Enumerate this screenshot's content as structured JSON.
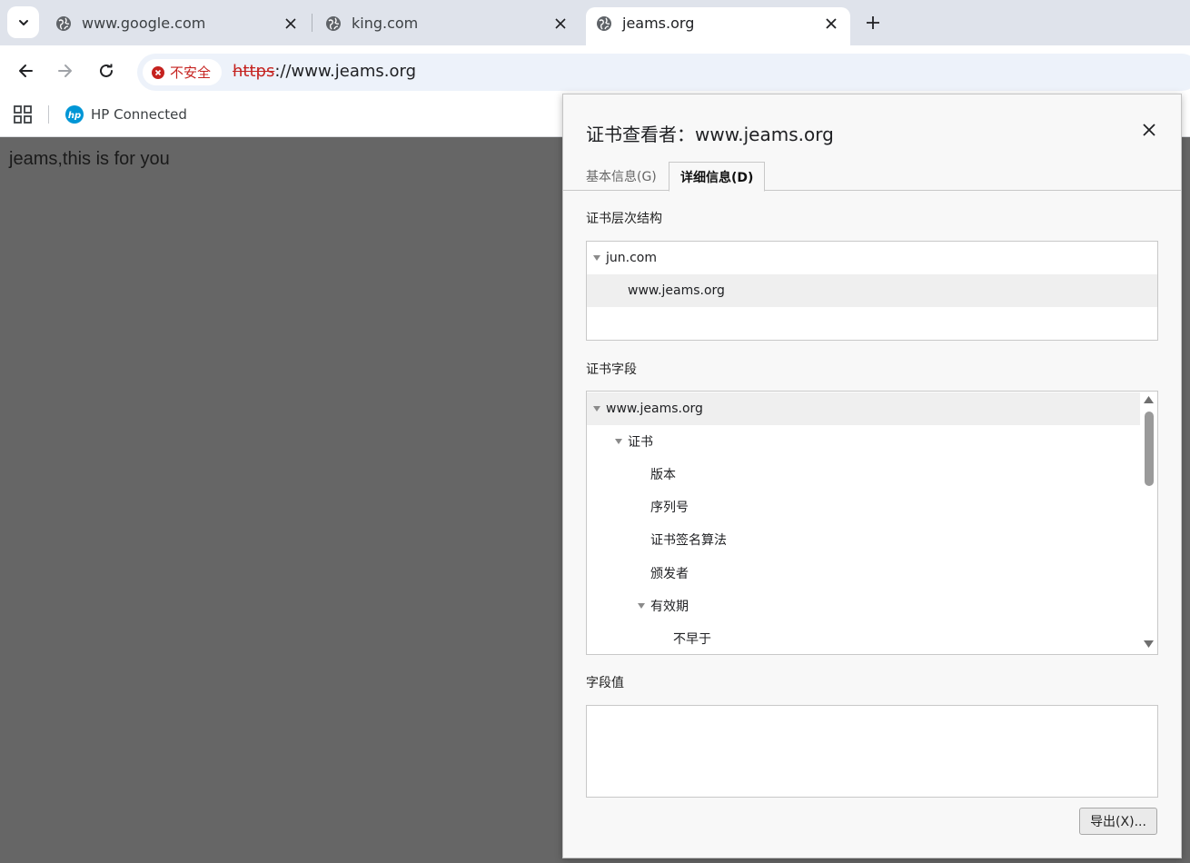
{
  "tabs": [
    {
      "title": "www.google.com",
      "icon": "globe-icon"
    },
    {
      "title": "king.com",
      "icon": "globe-icon"
    },
    {
      "title": "jeams.org",
      "icon": "globe-icon",
      "active": true
    }
  ],
  "toolbar": {
    "security_label": "不安全",
    "url_scheme": "https",
    "url_rest": "://www.jeams.org"
  },
  "bookmarks": [
    {
      "label": "HP Connected",
      "icon": "hp-logo-icon"
    }
  ],
  "page": {
    "body_text": "jeams,this is for you"
  },
  "dialog": {
    "title": "证书查看者：www.jeams.org",
    "tabs": {
      "general": "基本信息(G)",
      "details": "详细信息(D)"
    },
    "hierarchy_label": "证书层次结构",
    "hierarchy": [
      {
        "label": "jun.com",
        "level": 0,
        "expanded": true,
        "selected": false
      },
      {
        "label": "www.jeams.org",
        "level": 1,
        "selected": true
      }
    ],
    "fields_label": "证书字段",
    "fields": [
      {
        "label": "www.jeams.org",
        "level": 0,
        "expanded": true,
        "selected": true
      },
      {
        "label": "证书",
        "level": 1,
        "expanded": true
      },
      {
        "label": "版本",
        "level": 2
      },
      {
        "label": "序列号",
        "level": 2
      },
      {
        "label": "证书签名算法",
        "level": 2
      },
      {
        "label": "颁发者",
        "level": 2
      },
      {
        "label": "有效期",
        "level": 2,
        "expanded": true
      },
      {
        "label": "不早于",
        "level": 3
      }
    ],
    "value_label": "字段值",
    "field_value": "",
    "export_label": "导出(X)..."
  },
  "colors": {
    "insecure_red": "#c5221f",
    "page_bg": "#666666",
    "tabstrip_bg": "#dfe3eb"
  }
}
